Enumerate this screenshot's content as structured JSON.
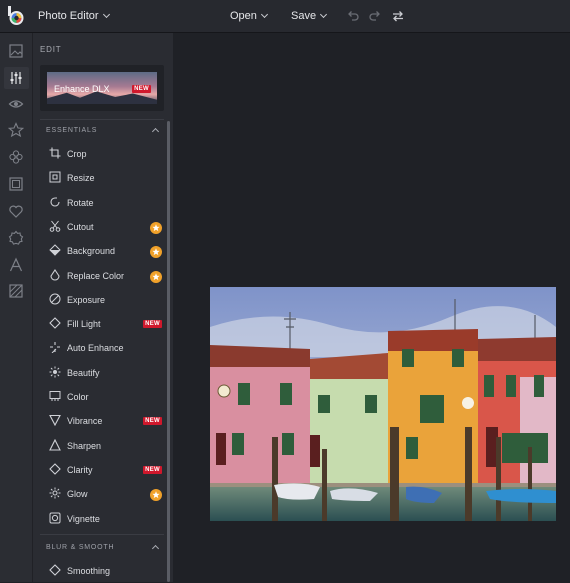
{
  "app": {
    "title": "Photo Editor"
  },
  "toolbar": {
    "open_label": "Open",
    "save_label": "Save"
  },
  "rail": {
    "icons": [
      "image-icon",
      "sliders-icon",
      "eye-icon",
      "star-icon",
      "flower-icon",
      "frame-icon",
      "heart-icon",
      "badge-icon",
      "text-icon",
      "texture-icon"
    ]
  },
  "panel": {
    "edit_label": "EDIT",
    "promo": {
      "title": "Enhance DLX",
      "badge": "NEW"
    },
    "essentials": {
      "label": "ESSENTIALS",
      "tools": [
        {
          "label": "Crop",
          "icon": "crop-icon"
        },
        {
          "label": "Resize",
          "icon": "resize-icon"
        },
        {
          "label": "Rotate",
          "icon": "rotate-icon"
        },
        {
          "label": "Cutout",
          "icon": "scissors-icon",
          "premium": true
        },
        {
          "label": "Background",
          "icon": "background-icon",
          "premium": true
        },
        {
          "label": "Replace Color",
          "icon": "replace-color-icon",
          "premium": true
        },
        {
          "label": "Exposure",
          "icon": "exposure-icon"
        },
        {
          "label": "Fill Light",
          "icon": "fill-light-icon",
          "badge": "NEW"
        },
        {
          "label": "Auto Enhance",
          "icon": "auto-enhance-icon"
        },
        {
          "label": "Beautify",
          "icon": "beautify-icon"
        },
        {
          "label": "Color",
          "icon": "color-icon"
        },
        {
          "label": "Vibrance",
          "icon": "vibrance-icon",
          "badge": "NEW"
        },
        {
          "label": "Sharpen",
          "icon": "sharpen-icon"
        },
        {
          "label": "Clarity",
          "icon": "clarity-icon",
          "badge": "NEW"
        },
        {
          "label": "Glow",
          "icon": "glow-icon",
          "premium": true
        },
        {
          "label": "Vignette",
          "icon": "vignette-icon"
        }
      ]
    },
    "blur_smooth": {
      "label": "BLUR & SMOOTH",
      "tools": [
        {
          "label": "Smoothing",
          "icon": "smoothing-icon"
        }
      ]
    }
  },
  "colors": {
    "accent_new": "#d0182c",
    "premium_star": "#f0a12a",
    "panel_bg": "#2a2c32",
    "canvas_bg": "#1f2126"
  }
}
